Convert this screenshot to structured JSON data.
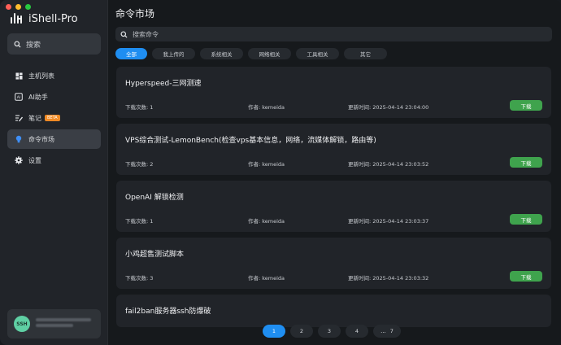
{
  "app": {
    "name": "iShell-Pro"
  },
  "sidebar": {
    "search_label": "搜索",
    "items": [
      {
        "label": "主机列表",
        "icon": "grid-icon"
      },
      {
        "label": "AI助手",
        "icon": "ai-icon"
      },
      {
        "label": "笔记",
        "icon": "note-icon",
        "badge": "BETA"
      },
      {
        "label": "命令市场",
        "icon": "bulb-icon"
      },
      {
        "label": "设置",
        "icon": "gear-icon"
      }
    ],
    "user": {
      "avatar_text": "SSH"
    }
  },
  "main": {
    "title": "命令市场",
    "search_placeholder": "搜索命令",
    "tabs": [
      "全部",
      "我上传的",
      "系统相关",
      "网络相关",
      "工具相关",
      "其它"
    ],
    "cards": [
      {
        "title": "Hyperspeed-三网测速",
        "downloads": "下载次数: 1",
        "author": "作者: kemeida",
        "updated": "更新时间: 2025-04-14 23:04:00",
        "button": "下载"
      },
      {
        "title": "VPS综合测试-LemonBench(检查vps基本信息，网络，流媒体解锁，路由等)",
        "downloads": "下载次数: 2",
        "author": "作者: kemeida",
        "updated": "更新时间: 2025-04-14 23:03:52",
        "button": "下载"
      },
      {
        "title": "OpenAI 解锁检测",
        "downloads": "下载次数: 1",
        "author": "作者: kemeida",
        "updated": "更新时间: 2025-04-14 23:03:37",
        "button": "下载"
      },
      {
        "title": "小鸡超售测试脚本",
        "downloads": "下载次数: 3",
        "author": "作者: kemeida",
        "updated": "更新时间: 2025-04-14 23:03:32",
        "button": "下载"
      },
      {
        "title": "fail2ban服务器ssh防爆破"
      }
    ],
    "pagination": {
      "pages": [
        "1",
        "2",
        "3",
        "4"
      ],
      "ellipsis": "...",
      "last": "7",
      "current": "1"
    }
  },
  "colors": {
    "accent": "#1f8ef1",
    "download": "#3fa34d",
    "beta": "#f08a24",
    "avatar": "#5fd0a4"
  }
}
